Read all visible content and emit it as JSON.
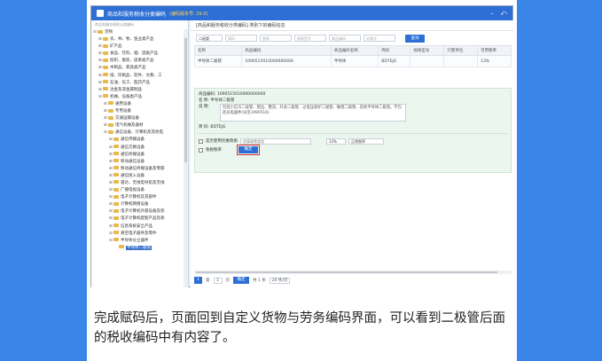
{
  "window": {
    "title": "商品和服务税收分类编码",
    "subtitle": "(编码版本号: 29.0)",
    "min_glyph": "–",
    "restore_glyph": "⤺"
  },
  "tree": {
    "top_hint": "商品和服务税收分类编码",
    "items": [
      {
        "indent": 0,
        "toggle": "⊟",
        "label": "货物"
      },
      {
        "indent": 1,
        "toggle": "⊞",
        "label": "农、林、牧、渔业类产品"
      },
      {
        "indent": 1,
        "toggle": "⊞",
        "label": "矿产品"
      },
      {
        "indent": 1,
        "toggle": "⊞",
        "label": "食品、饮料、烟、酒类产品"
      },
      {
        "indent": 1,
        "toggle": "⊞",
        "label": "纺织、服装、皮革类产品"
      },
      {
        "indent": 1,
        "toggle": "⊞",
        "label": "木制品、家具类产品"
      },
      {
        "indent": 1,
        "toggle": "⊞",
        "label": "纸、印刷品、软件、文教、工"
      },
      {
        "indent": 1,
        "toggle": "⊞",
        "label": "石油、化工、医药产品"
      },
      {
        "indent": 1,
        "toggle": "⊞",
        "label": "冶金及非金属制品"
      },
      {
        "indent": 1,
        "toggle": "⊟",
        "label": "机械、设备类产品"
      },
      {
        "indent": 2,
        "toggle": "⊞",
        "label": "通用设备"
      },
      {
        "indent": 2,
        "toggle": "⊞",
        "label": "专用设备"
      },
      {
        "indent": 2,
        "toggle": "⊞",
        "label": "交通运输设备"
      },
      {
        "indent": 2,
        "toggle": "⊞",
        "label": "电气机械及器材"
      },
      {
        "indent": 2,
        "toggle": "⊟",
        "label": "通信设备、计算机及其他电"
      },
      {
        "indent": 3,
        "toggle": "⊞",
        "label": "通信传输设备"
      },
      {
        "indent": 3,
        "toggle": "⊞",
        "label": "通信交换设备"
      },
      {
        "indent": 3,
        "toggle": "⊞",
        "label": "通信终端设备"
      },
      {
        "indent": 3,
        "toggle": "⊞",
        "label": "移动通信设备"
      },
      {
        "indent": 3,
        "toggle": "⊞",
        "label": "移动通信终端设备及零部"
      },
      {
        "indent": 3,
        "toggle": "⊞",
        "label": "通信接入设备"
      },
      {
        "indent": 3,
        "toggle": "⊞",
        "label": "雷达、无线电导航及无线"
      },
      {
        "indent": 3,
        "toggle": "⊞",
        "label": "广播电视设备"
      },
      {
        "indent": 3,
        "toggle": "⊞",
        "label": "电子计算机及其部件"
      },
      {
        "indent": 3,
        "toggle": "⊞",
        "label": "计算机网络设备"
      },
      {
        "indent": 3,
        "toggle": "⊞",
        "label": "电子计算机外部设备及装"
      },
      {
        "indent": 3,
        "toggle": "⊞",
        "label": "电子计算机配套产品及耗"
      },
      {
        "indent": 3,
        "toggle": "⊞",
        "label": "信息系统安全产品"
      },
      {
        "indent": 3,
        "toggle": "⊟",
        "label": "真空电子器件及零件"
      },
      {
        "indent": 3,
        "toggle": "⊟",
        "label": "半导体分立器件"
      },
      {
        "indent": 4,
        "toggle": "",
        "label": "半导体二极管",
        "selected": true
      }
    ]
  },
  "breadcrumb": "[商品和服务税收分类编码] 类别下的编码信息",
  "search": {
    "fields": [
      {
        "label": "二极管",
        "placeholder": ""
      },
      {
        "label": "",
        "placeholder": "简码"
      },
      {
        "label": "",
        "placeholder": "税率"
      },
      {
        "label": "",
        "placeholder": "规格型号"
      },
      {
        "label": "",
        "placeholder": "商品编码"
      },
      {
        "label": "",
        "placeholder": "关键字"
      }
    ],
    "button": "查询"
  },
  "table": {
    "headers": [
      "名称",
      "商品编码",
      "商品编码名称",
      "简码",
      "规格型号",
      "计量单位",
      "可用税率"
    ],
    "rows": [
      [
        "半导体二极管",
        "1090515010000000000",
        "半导体",
        "BDTEJG",
        "",
        "",
        "13%"
      ]
    ]
  },
  "detail": {
    "code_line": "商品编码: 1090515010000000000",
    "name_line": "名    称: 半导体二极管",
    "desc_label": "说    明:",
    "desc_text": "包括小信号二极管、稳压、整流、开关二极管、过电压保护二极管、敏感二极管、其他半导体二极管。不包括光电器件(详见1090516)",
    "short_line": "简    码: BDTEJG",
    "pref_label": "是否使用优惠政策",
    "pref_placeholder": "优惠政策类型",
    "rate_value": "13%",
    "rate_type": "正常税率",
    "tax_free_label": "免税税率",
    "confirm": "确定"
  },
  "pager": {
    "page_label": "第",
    "page_value": "1",
    "total_label": "页",
    "go": "确定",
    "count": "共 1 条",
    "per_page": "20 条/页"
  },
  "caption": "完成赋码后，页面回到自定义货物与劳务编码界面，可以看到二极管后面的税收编码中有内容了。",
  "colors": {
    "accent": "#2d6fd4",
    "page_bg": "#3a86e8",
    "highlight": "#d8322e"
  }
}
